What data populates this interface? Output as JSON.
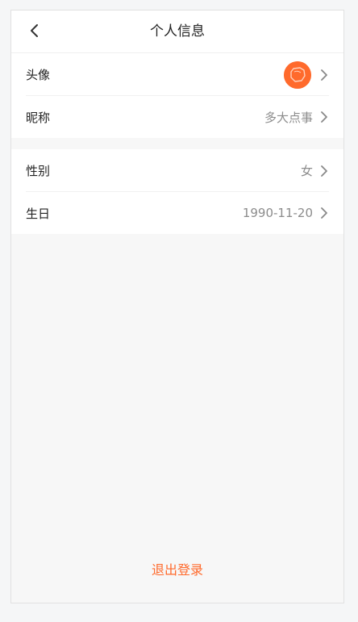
{
  "header": {
    "title": "个人信息",
    "back_icon": "chevron-left-icon"
  },
  "profile_group": {
    "avatar": {
      "label": "头像",
      "avatar_color": "#ff6a2c",
      "icon": "avatar-image"
    },
    "nickname": {
      "label": "昵称",
      "value": "多大点事"
    }
  },
  "detail_group": {
    "gender": {
      "label": "性别",
      "value": "女"
    },
    "birthday": {
      "label": "生日",
      "value": "1990-11-20"
    }
  },
  "footer": {
    "logout_label": "退出登录"
  },
  "colors": {
    "accent": "#ff6a2c",
    "text_primary": "#222222",
    "text_secondary": "#8c8c8c",
    "background": "#f7f7f7"
  },
  "row_chevron_icon": "chevron-right-icon"
}
